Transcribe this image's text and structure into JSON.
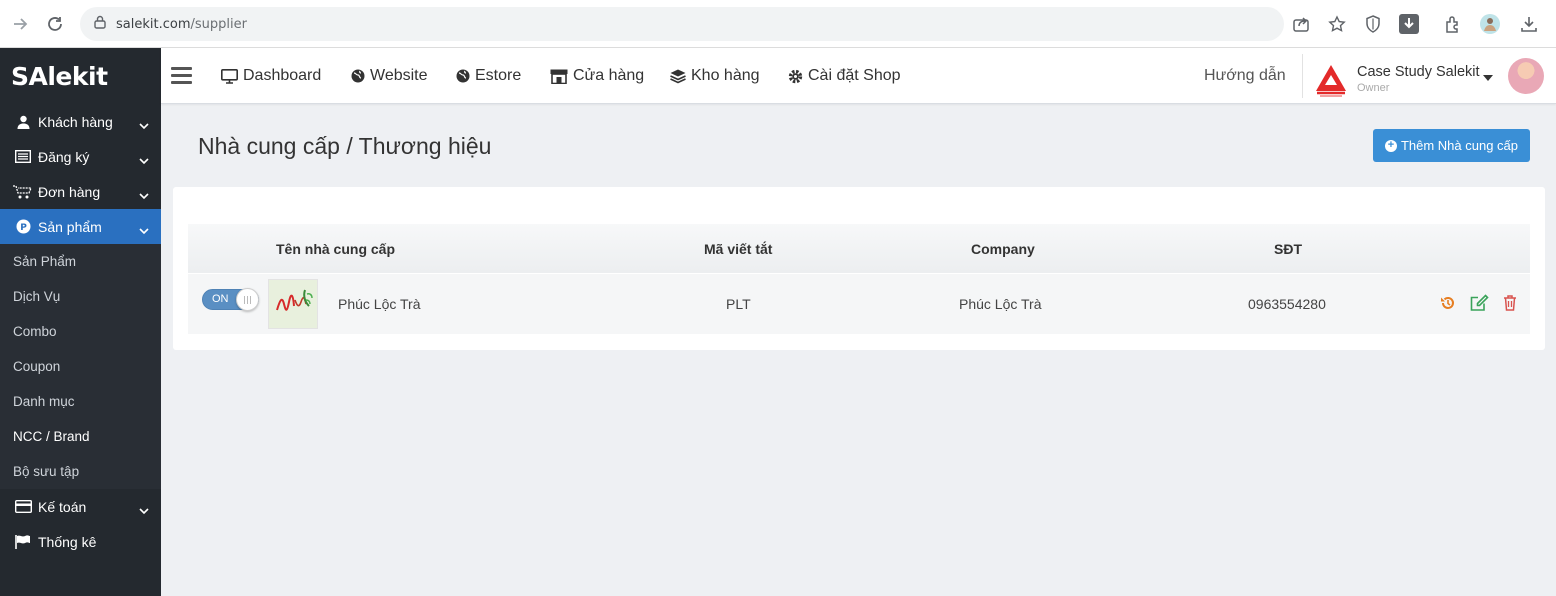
{
  "browser": {
    "url_domain": "salekit.com",
    "url_path": "/supplier"
  },
  "sidebar": {
    "logo": "SAlekit",
    "items": [
      {
        "label": "Khách hàng",
        "icon": "user-icon"
      },
      {
        "label": "Đăng ký",
        "icon": "list-icon"
      },
      {
        "label": "Đơn hàng",
        "icon": "cart-icon"
      },
      {
        "label": "Sản phẩm",
        "icon": "product-icon",
        "active": true
      }
    ],
    "submenu": [
      "Sản Phẩm",
      "Dịch Vụ",
      "Combo",
      "Coupon",
      "Danh mục",
      "NCC / Brand",
      "Bộ sưu tập"
    ],
    "bottom_items": [
      {
        "label": "Kế toán",
        "icon": "credit-card-icon"
      },
      {
        "label": "Thống kê",
        "icon": "flag-icon"
      }
    ]
  },
  "topnav": {
    "links": [
      "Dashboard",
      "Website",
      "Estore",
      "Cửa hàng",
      "Kho hàng",
      "Cài đặt Shop"
    ],
    "guide": "Hướng dẫn",
    "account_name": "Case Study Salekit",
    "account_role": "Owner"
  },
  "page": {
    "title": "Nhà cung cấp / Thương hiệu",
    "add_button": "Thêm Nhà cung cấp"
  },
  "table": {
    "headers": [
      "Tên nhà cung cấp",
      "Mã viết tắt",
      "Company",
      "SĐT"
    ],
    "rows": [
      {
        "toggle": "ON",
        "name": "Phúc Lộc Trà",
        "code": "PLT",
        "company": "Phúc Lộc Trà",
        "phone": "0963554280"
      }
    ]
  },
  "colors": {
    "sidebar_bg": "#24292f",
    "accent": "#2a70c0",
    "button": "#3a8fd6",
    "restore": "#e67e22",
    "edit": "#3aa35a",
    "delete": "#d9534f"
  }
}
